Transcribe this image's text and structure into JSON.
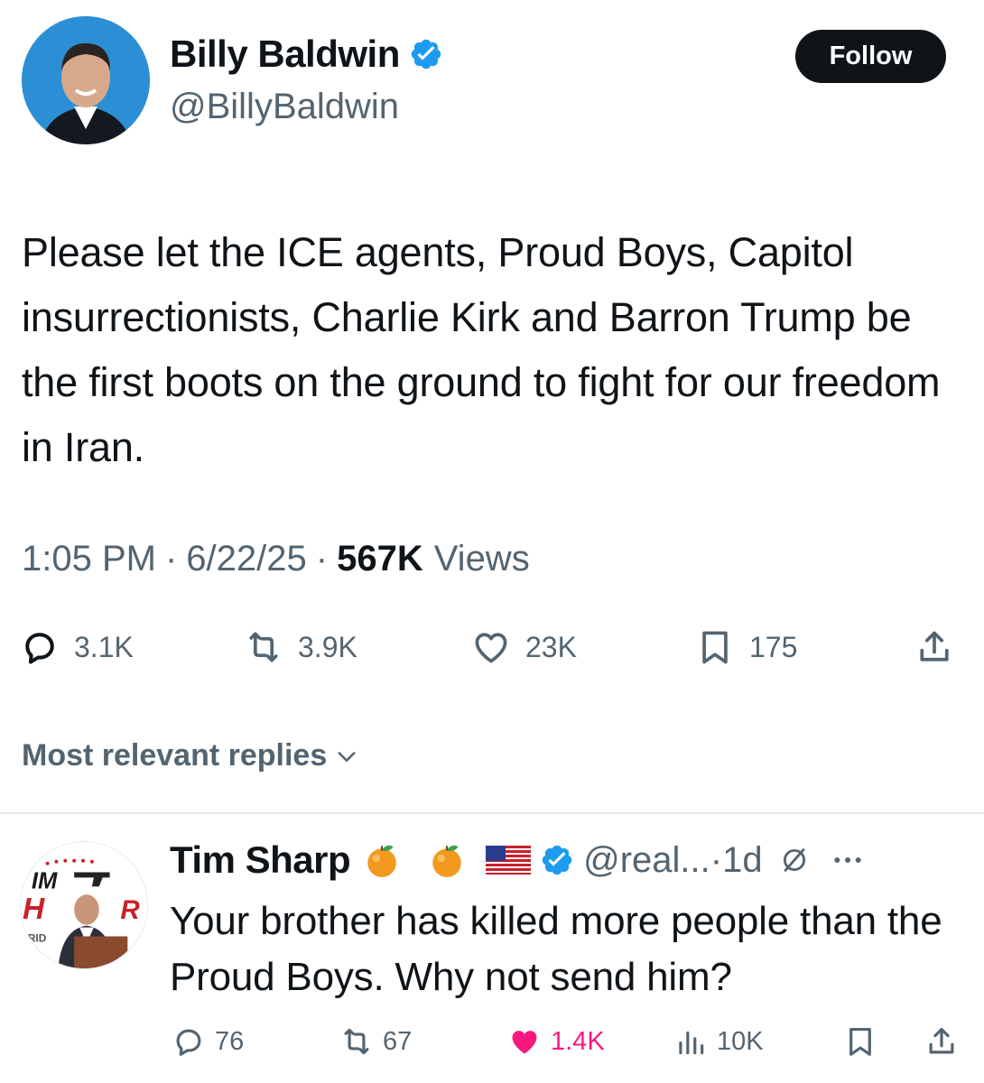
{
  "author": {
    "display_name": "Billy Baldwin",
    "handle": "@BillyBaldwin",
    "verified": true,
    "follow_label": "Follow"
  },
  "tweet": {
    "text": "Please let the ICE agents, Proud Boys, Capitol insurrectionists, Charlie Kirk and Barron Trump be the first boots on the ground to fight for our freedom in Iran.",
    "time": "1:05 PM",
    "date": "6/22/25",
    "views_count": "567K",
    "views_label": "Views"
  },
  "stats": {
    "replies": "3.1K",
    "reposts": "3.9K",
    "likes": "23K",
    "bookmarks": "175"
  },
  "replies_section": {
    "sort_label": "Most relevant replies"
  },
  "reply": {
    "display_name": "Tim Sharp",
    "handle": "@real...",
    "time": "1d",
    "text": "Your brother has killed more people than the Proud Boys. Why not send him?",
    "stats": {
      "replies": "76",
      "reposts": "67",
      "likes": "1.4K",
      "views": "10K"
    },
    "emojis": [
      "tangerine-emoji",
      "tangerine-emoji",
      "us-flag-emoji"
    ]
  },
  "colors": {
    "text_primary": "#0f1419",
    "text_secondary": "#536471",
    "verified_blue": "#1d9bf0",
    "like_pink": "#f91880",
    "divider": "#e6e9eb"
  }
}
